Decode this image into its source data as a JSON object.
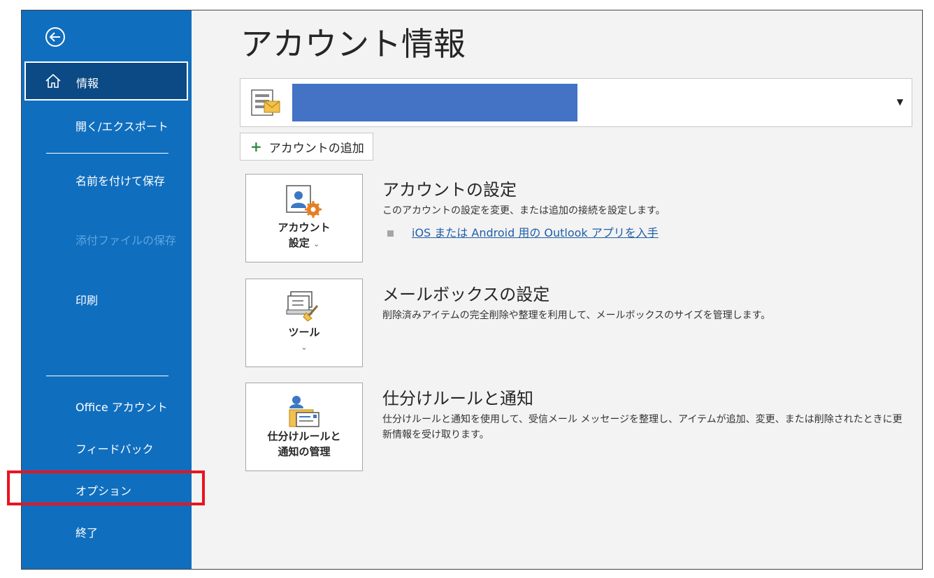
{
  "sidebar": {
    "info": "情報",
    "open_export": "開く/エクスポート",
    "save_as": "名前を付けて保存",
    "save_attachments": "添付ファイルの保存",
    "print": "印刷",
    "office_account": "Office アカウント",
    "feedback": "フィードバック",
    "options": "オプション",
    "exit": "終了"
  },
  "main": {
    "title": "アカウント情報",
    "add_account": "アカウントの追加",
    "sections": [
      {
        "tile_label_1": "アカウント",
        "tile_label_2": "設定",
        "title": "アカウントの設定",
        "description": "このアカウントの設定を変更、または追加の接続を設定します。",
        "link": "iOS または Android 用の Outlook アプリを入手"
      },
      {
        "tile_label_1": "ツール",
        "title": "メールボックスの設定",
        "description": "削除済みアイテムの完全削除や整理を利用して、メールボックスのサイズを管理します。"
      },
      {
        "tile_label_1": "仕分けルールと",
        "tile_label_2": "通知の管理",
        "title": "仕分けルールと通知",
        "description": "仕分けルールと通知を使用して、受信メール メッセージを整理し、アイテムが追加、変更、または削除されたときに更新情報を受け取ります。"
      }
    ]
  },
  "colors": {
    "sidebar": "#106ebe",
    "selected_item": "#0b4a84",
    "highlight_box": "#e8141f",
    "redacted_account": "#4472c4",
    "link": "#1f5ea8"
  },
  "icons": [
    "back-arrow-icon",
    "home-icon",
    "account-file-icon",
    "dropdown-caret-icon",
    "plus-icon",
    "account-settings-icon",
    "tools-icon",
    "rules-alerts-icon",
    "chevron-down-icon",
    "bullet-icon"
  ]
}
